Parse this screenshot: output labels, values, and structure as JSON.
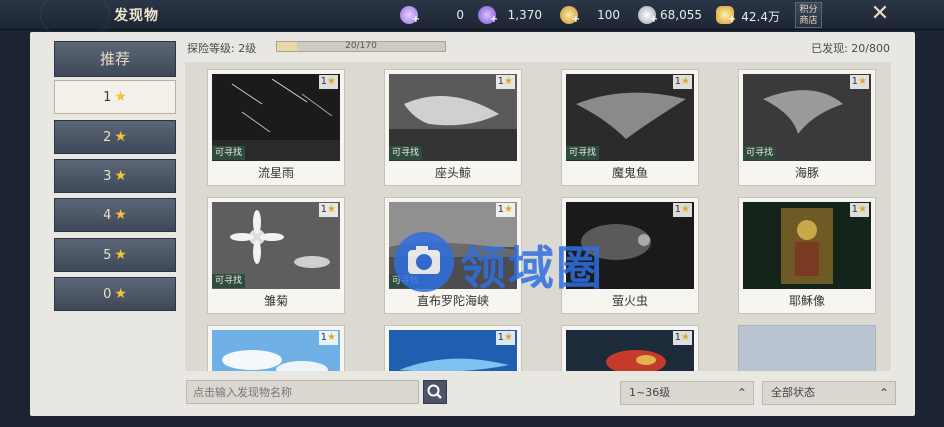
{
  "header": {
    "title": "发现物",
    "resources": [
      {
        "icon": "purple-gem-icon",
        "value": "0",
        "color": "#b58cf0"
      },
      {
        "icon": "purple-gem-icon",
        "value": "1,370",
        "color": "#9a6fe0"
      },
      {
        "icon": "gold-coin-icon",
        "value": "100",
        "color": "#d6a93a"
      },
      {
        "icon": "silver-coin-icon",
        "value": "68,055",
        "color": "#c8ccd2"
      },
      {
        "icon": "gold-ingot-icon",
        "value": "42.4万",
        "color": "#e3b338"
      }
    ],
    "shop_label": "积分商店",
    "close_icon": "close-icon"
  },
  "sidebar": {
    "recommend_label": "推荐",
    "items": [
      {
        "label": "1",
        "active": true
      },
      {
        "label": "2"
      },
      {
        "label": "3"
      },
      {
        "label": "4"
      },
      {
        "label": "5"
      },
      {
        "label": "0"
      }
    ]
  },
  "progress": {
    "label": "探险等级: 2级",
    "text": "20/170",
    "fraction": 0.1176
  },
  "discovered": "已发现: 20/800",
  "cards": [
    {
      "name": "流星雨",
      "badge": "1",
      "tag": "可寻找",
      "scene": "meteor"
    },
    {
      "name": "座头鲸",
      "badge": "1",
      "tag": "可寻找",
      "scene": "whale"
    },
    {
      "name": "魔鬼鱼",
      "badge": "1",
      "tag": "可寻找",
      "scene": "manta"
    },
    {
      "name": "海豚",
      "badge": "1",
      "tag": "可寻找",
      "scene": "dolphin"
    },
    {
      "name": "雏菊",
      "badge": "1",
      "tag": "可寻找",
      "scene": "daisy"
    },
    {
      "name": "直布罗陀海峡",
      "badge": "1",
      "tag": "可寻找",
      "scene": "strait"
    },
    {
      "name": "萤火虫",
      "badge": "1",
      "tag": "",
      "scene": "firefly"
    },
    {
      "name": "耶稣像",
      "badge": "1",
      "tag": "",
      "scene": "icon"
    },
    {
      "name": "",
      "badge": "1",
      "tag": "",
      "scene": "sky"
    },
    {
      "name": "",
      "badge": "1",
      "tag": "",
      "scene": "ocean"
    },
    {
      "name": "",
      "badge": "1",
      "tag": "",
      "scene": "fish"
    },
    {
      "name": "",
      "badge": "",
      "tag": "",
      "scene": "locked"
    }
  ],
  "search": {
    "placeholder": "点击输入发现物名称"
  },
  "filters": {
    "level": "1~36级",
    "status": "全部状态"
  },
  "watermark": "领域圈"
}
